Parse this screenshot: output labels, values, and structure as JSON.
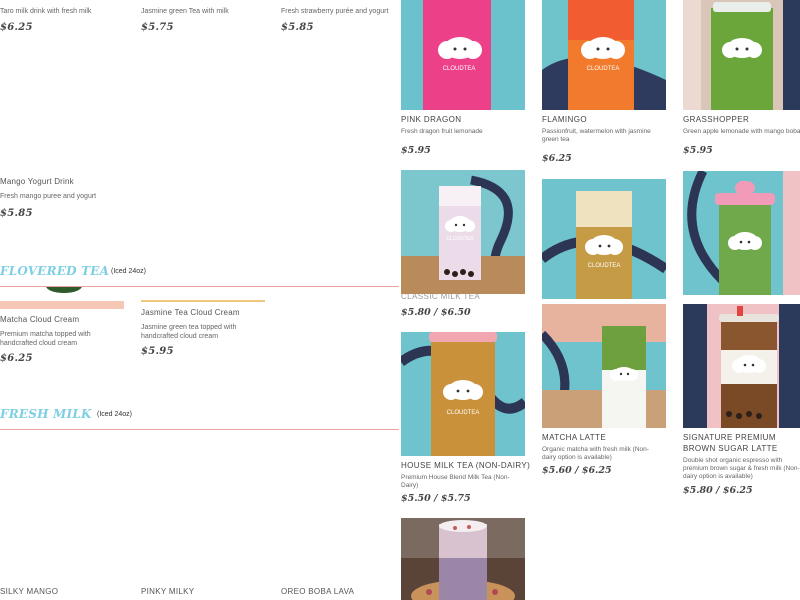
{
  "left_top_row": [
    {
      "desc": "Taro milk drink with fresh milk",
      "price": "$6.25"
    },
    {
      "desc": "Jasmine green Tea with milk",
      "price": "$5.75"
    },
    {
      "desc": "Fresh strawberry purée and yogurt",
      "price": "$5.85"
    }
  ],
  "mango_yogurt": {
    "name": "Mango Yogurt Drink",
    "desc": "Fresh mango puree and yogurt",
    "price": "$5.85"
  },
  "flowered_tea": {
    "title": "FLOVERED TEA",
    "note": "(Iced 24oz)"
  },
  "cloud_cream": [
    {
      "name": "Matcha Cloud Cream",
      "desc": "Premium matcha topped with handcrafted cloud cream",
      "price": "$6.25"
    },
    {
      "name": "Jasmine Tea Cloud Cream",
      "desc": "Jasmine green tea topped with handcrafted cloud cream",
      "price": "$5.95"
    }
  ],
  "fresh_milk": {
    "title": "FRESH MILK",
    "note": "(Iced 24oz)"
  },
  "bottom_names": [
    "SILKY MANGO",
    "PINKY MILKY",
    "OREO BOBA LAVA"
  ],
  "cards": {
    "pink_dragon": {
      "name": "PINK DRAGON",
      "desc": "Fresh dragon fruit lemonade",
      "price": "$5.95"
    },
    "flamingo": {
      "name": "FLAMINGO",
      "desc": "Passionfruit, watermelon with jasmine green tea",
      "price": "$6.25"
    },
    "grasshopper": {
      "name": "GRASSHOPPER",
      "desc": "Green apple lemonade with mango boba",
      "price": "$5.95"
    },
    "milk_tea_partial": {
      "name": "Classic Milk Tea",
      "price": "$5.80 / $6.50"
    },
    "house_milk_tea": {
      "name": "HOUSE MILK TEA (NON-DAIRY)",
      "desc": "Premium House Blend Milk Tea (Non-Dairy)",
      "price": "$5.50 / $5.75"
    },
    "matcha_latte": {
      "name": "MATCHA LATTE",
      "desc": "Organic matcha with fresh milk (Non-dairy option is available)",
      "price": "$5.60 / $6.25"
    },
    "signature_latte": {
      "name": "SIGNATURE PREMIUM BROWN SUGAR LATTE",
      "desc": "Double shot organic espresso with premium brown sugar & fresh milk (Non-dairy option is available)",
      "price": "$5.80 / $6.25"
    }
  },
  "logo_text": "CLOUDTEA",
  "colors": {
    "accent_blue": "#7ecfe2",
    "rule_pink": "#e9a3a0",
    "peach": "#f6c7b5",
    "gold": "#f1c77f",
    "wall_teal": "#5ec3cf"
  }
}
